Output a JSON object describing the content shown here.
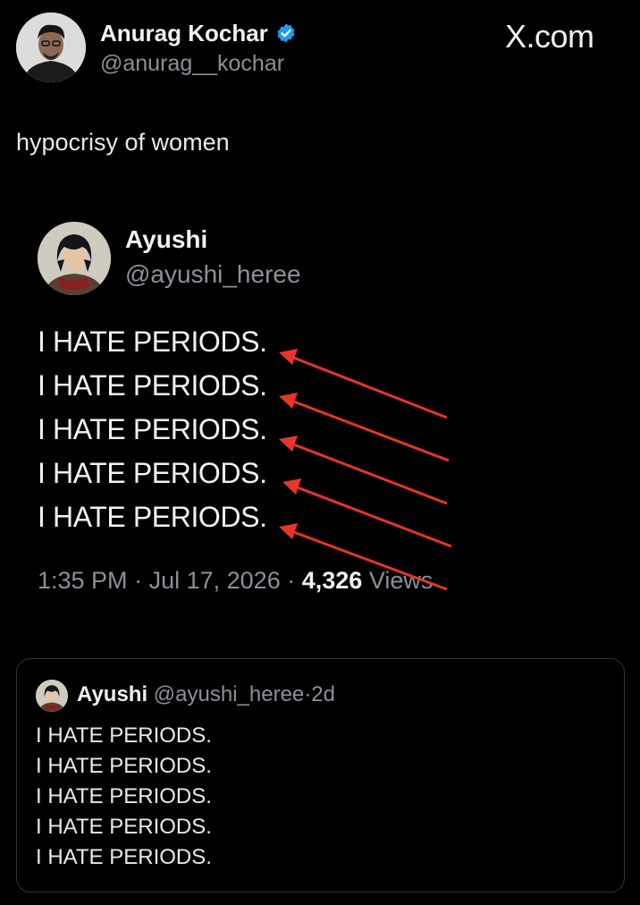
{
  "header": {
    "author_name": "Anurag Kochar",
    "author_handle": "@anurag__kochar",
    "brand": "X.com",
    "tweet_text": "hypocrisy of women"
  },
  "embedded": {
    "name": "Ayushi",
    "handle": "@ayushi_heree",
    "lines": [
      "I HATE PERIODS.",
      "I HATE PERIODS.",
      "I HATE PERIODS.",
      "I HATE PERIODS.",
      "I HATE PERIODS."
    ],
    "time": "1:35 PM",
    "date": "Jul 17, 2026",
    "views_count": "4,326",
    "views_label": "Views",
    "separator": "·"
  },
  "quoted": {
    "name": "Ayushi",
    "handle": "@ayushi_heree",
    "separator": "·",
    "age": "2d",
    "lines": [
      "I HATE PERIODS.",
      "I HATE PERIODS.",
      "I HATE PERIODS.",
      "I HATE PERIODS.",
      "I HATE PERIODS."
    ]
  },
  "colors": {
    "background": "#000000",
    "verified": "#1d9bf0",
    "arrow": "#e8342a",
    "muted": "#8b9098"
  },
  "icons": [
    "verified-badge-icon",
    "red-arrow-icon"
  ]
}
